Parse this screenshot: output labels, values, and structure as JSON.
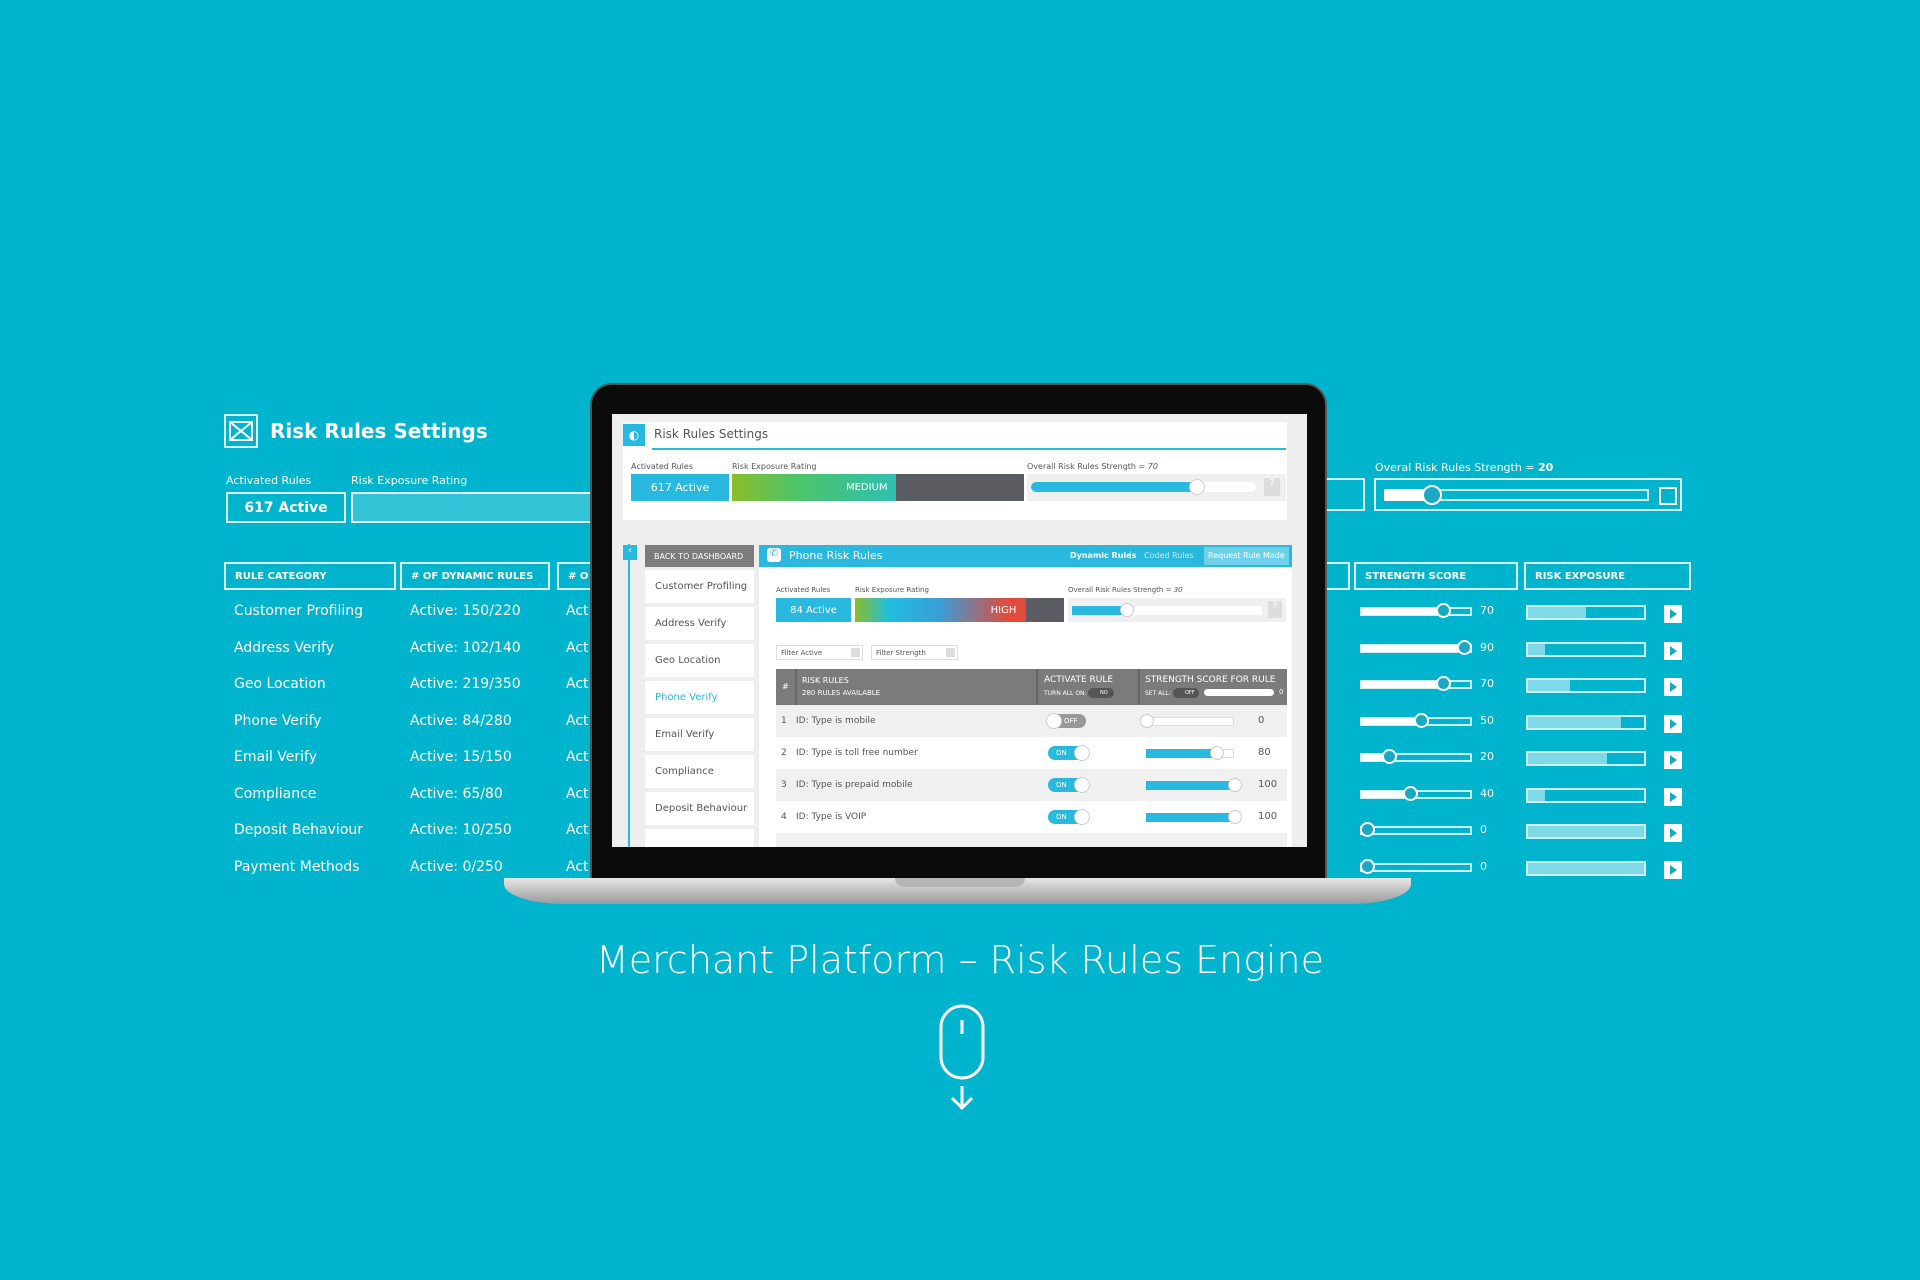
{
  "bg": {
    "title": "Risk Rules Settings",
    "activated_label": "Activated Rules",
    "activated_value": "617 Active",
    "exposure_label": "Risk Exposure Rating",
    "strength_label": "Overal Risk Rules Strength = ",
    "strength_value": "20",
    "strength_fraction": 0.18,
    "headers": [
      "RULE CATEGORY",
      "# OF DYNAMIC RULES",
      "# O",
      "STRENGTH SCORE",
      "RISK EXPOSURE"
    ],
    "rows": [
      {
        "category": "Customer Profiling",
        "dynamic": "Active: 150/220",
        "third": "Act",
        "score": 70,
        "exposure": 0.5
      },
      {
        "category": "Address Verify",
        "dynamic": "Active: 102/140",
        "third": "Act",
        "score": 90,
        "exposure": 0.15
      },
      {
        "category": "Geo Location",
        "dynamic": "Active: 219/350",
        "third": "Act",
        "score": 70,
        "exposure": 0.36
      },
      {
        "category": "Phone Verify",
        "dynamic": "Active: 84/280",
        "third": "Act",
        "score": 50,
        "exposure": 0.8
      },
      {
        "category": "Email Verify",
        "dynamic": "Active: 15/150",
        "third": "Act",
        "score": 20,
        "exposure": 0.68
      },
      {
        "category": "Compliance",
        "dynamic": "Active: 65/80",
        "third": "Act",
        "score": 40,
        "exposure": 0.15
      },
      {
        "category": "Deposit Behaviour",
        "dynamic": "Active: 10/250",
        "third": "Act",
        "score": 0,
        "exposure": 1.0
      },
      {
        "category": "Payment Methods",
        "dynamic": "Active: 0/250",
        "third": "Act",
        "score": 0,
        "exposure": 1.0
      }
    ]
  },
  "screen": {
    "title": "Risk Rules Settings",
    "activated_label": "Activated Rules",
    "activated_value": "617 Active",
    "exposure_label": "Risk Exposure Rating",
    "exposure_value": "MEDIUM",
    "strength_label": "Overall Risk Rules Strength = ",
    "strength_value": "70",
    "help": "?",
    "back": "BACK TO DASHBOARD",
    "sidebar": [
      "Customer Profiling",
      "Address Verify",
      "Geo Location",
      "Phone Verify",
      "Email Verify",
      "Compliance",
      "Deposit Behaviour"
    ],
    "active_sidebar": "Phone Verify",
    "panel": {
      "title": "Phone Risk Rules",
      "tab_dynamic": "Dynamic Rules",
      "sep": "|",
      "tab_coded": "Coded Rules",
      "request": "Request Rule Made",
      "activated_label": "Activated Rules",
      "activated_value": "84 Active",
      "exposure_label": "Risk Exposure Rating",
      "exposure_value": "HIGH",
      "strength_label": "Overall Risk Rules Strength = ",
      "strength_value": "30",
      "help": "?",
      "filter_active": "Filter Active",
      "filter_strength": "Filter Strength",
      "th_num": "#",
      "th_rules": "RISK RULES",
      "th_available": "280 RULES AVAILABLE",
      "th_activate": "ACTIVATE RULE",
      "th_turn_all": "TURN ALL ON:",
      "th_turn_all_state": "NO",
      "th_strength": "STRENGTH SCORE FOR RULE",
      "th_set_all": "SET ALL:",
      "th_set_all_state": "OFF",
      "th_set_all_value": "0",
      "rules": [
        {
          "n": "1",
          "name": "ID: Type is mobile",
          "on": false,
          "state": "OFF",
          "score": 0
        },
        {
          "n": "2",
          "name": "ID: Type is toll free number",
          "on": true,
          "state": "ON",
          "score": 80
        },
        {
          "n": "3",
          "name": "ID: Type is prepaid mobile",
          "on": true,
          "state": "ON",
          "score": 100
        },
        {
          "n": "4",
          "name": "ID: Type is VOIP",
          "on": true,
          "state": "ON",
          "score": 100
        }
      ]
    }
  },
  "caption": "Merchant Platform – Risk Rules Engine",
  "colors": {
    "background": "#00b4cd",
    "accent": "#29b8de",
    "high": "#e14b3b",
    "medium": "#4cc46a"
  }
}
